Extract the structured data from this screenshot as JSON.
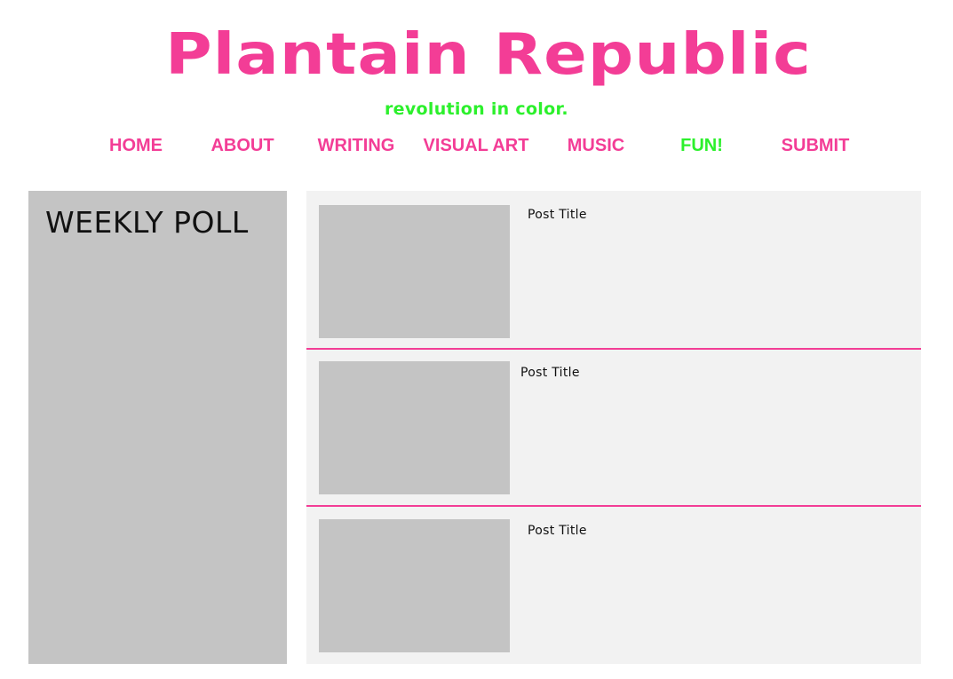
{
  "site": {
    "title": "Plantain Republic",
    "tagline": "revolution in color."
  },
  "nav": {
    "items": [
      {
        "label": "HOME"
      },
      {
        "label": "ABOUT"
      },
      {
        "label": "WRITING"
      },
      {
        "label": "VISUAL ART"
      },
      {
        "label": "MUSIC"
      },
      {
        "label": "FUN!"
      },
      {
        "label": "SUBMIT"
      }
    ]
  },
  "poll": {
    "title": "WEEKLY POLL"
  },
  "posts": [
    {
      "title": "Post Title"
    },
    {
      "title": "Post Title"
    },
    {
      "title": "Post Title"
    }
  ],
  "colors": {
    "brand_pink": "#f33d96",
    "accent_green": "#2cf02c",
    "panel_gray": "#c4c4c4",
    "content_bg": "#f2f2f2"
  }
}
